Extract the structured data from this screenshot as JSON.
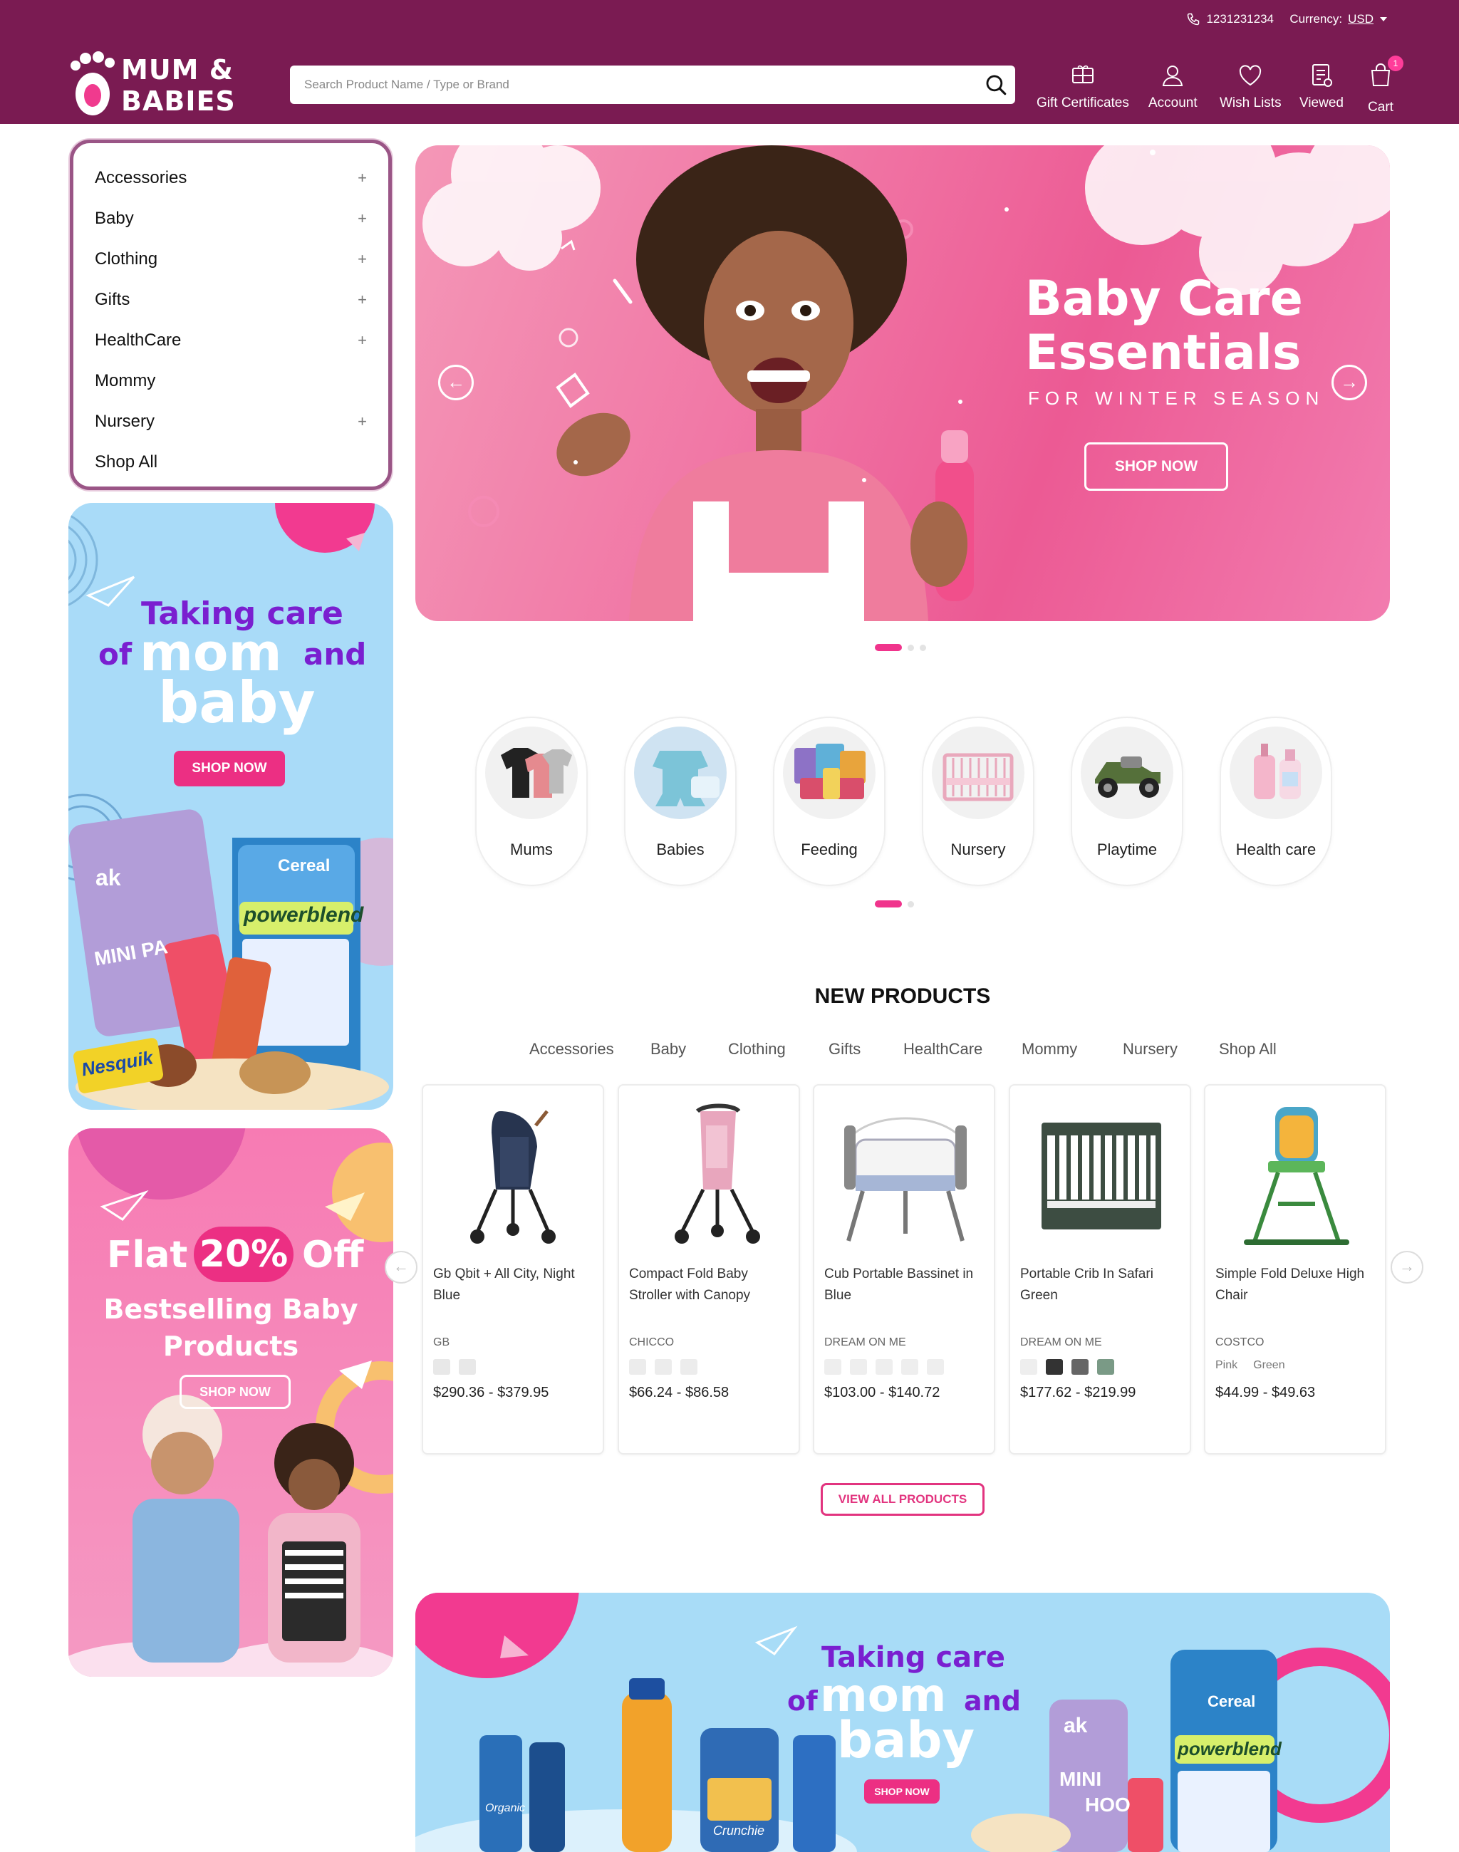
{
  "topbar": {
    "phone": "1231231234",
    "currency_label": "Currency:",
    "currency_value": "USD"
  },
  "header": {
    "logo_text_1": "MUM &",
    "logo_text_2": "BABIES",
    "search_placeholder": "Search Product Name / Type or Brand",
    "nav": [
      {
        "label": "Gift Certificates",
        "icon": "gift-certificate-icon"
      },
      {
        "label": "Account",
        "icon": "user-icon"
      },
      {
        "label": "Wish Lists",
        "icon": "heart-icon"
      },
      {
        "label": "Viewed",
        "icon": "viewed-list-icon"
      },
      {
        "label": "Cart",
        "icon": "shopping-bag-icon",
        "badge": "1"
      }
    ]
  },
  "sidebar": {
    "categories": [
      {
        "label": "Accessories",
        "expand": "+"
      },
      {
        "label": "Baby",
        "expand": "+"
      },
      {
        "label": "Clothing",
        "expand": "+"
      },
      {
        "label": "Gifts",
        "expand": "+"
      },
      {
        "label": "HealthCare",
        "expand": "+"
      },
      {
        "label": "Mommy",
        "expand": ""
      },
      {
        "label": "Nursery",
        "expand": "+"
      },
      {
        "label": "Shop All",
        "expand": ""
      }
    ],
    "banner1": {
      "line1": "Taking care",
      "line2a": "of",
      "line2b": "mom",
      "line2c": "and",
      "line3": "baby",
      "button": "SHOP NOW",
      "pkg_text_1": "Cereal",
      "pkg_text_2": "powerblend",
      "pkg_text_3": "ak",
      "pkg_text_4": "MINI PA",
      "pkg_text_5": "Nesquik"
    },
    "banner2": {
      "line1a": "Flat",
      "line1b": "20%",
      "line1c": "Off",
      "line2": "Bestselling Baby",
      "line3": "Products",
      "button": "SHOP NOW"
    }
  },
  "hero": {
    "title_1": "Baby Care",
    "title_2": "Essentials",
    "subtitle": "FOR WINTER SEASON",
    "button": "SHOP NOW",
    "prev": "←",
    "next": "→"
  },
  "category_circles": [
    {
      "label": "Mums"
    },
    {
      "label": "Babies"
    },
    {
      "label": "Feeding"
    },
    {
      "label": "Nursery"
    },
    {
      "label": "Playtime"
    },
    {
      "label": "Health care"
    }
  ],
  "new_products": {
    "title": "NEW PRODUCTS",
    "tabs": [
      "Accessories",
      "Baby",
      "Clothing",
      "Gifts",
      "HealthCare",
      "Mommy",
      "Nursery",
      "Shop All"
    ],
    "items": [
      {
        "name": "Gb Qbit + All City, Night Blue",
        "brand": "GB",
        "price": "$290.36 - $379.95"
      },
      {
        "name": "Compact Fold Baby Stroller with Canopy",
        "brand": "CHICCO",
        "price": "$66.24 - $86.58"
      },
      {
        "name": "Cub Portable Bassinet in Blue",
        "brand": "DREAM ON ME",
        "price": "$103.00 - $140.72"
      },
      {
        "name": "Portable Crib In Safari Green",
        "brand": "DREAM ON ME",
        "price": "$177.62 - $219.99"
      },
      {
        "name": "Simple Fold Deluxe High Chair",
        "brand": "COSTCO",
        "price": "$44.99 - $49.63",
        "swatch_1": "Pink",
        "swatch_2": "Green"
      }
    ],
    "view_all": "VIEW ALL PRODUCTS",
    "prev": "←",
    "next": "→"
  },
  "bottom_banner": {
    "line1": "Taking care",
    "line2a": "of",
    "line2b": "mom",
    "line2c": "and",
    "line3": "baby",
    "button": "SHOP NOW",
    "pkg_text_1": "Cereal",
    "pkg_text_2": "powerblend",
    "pkg_text_3": "Organic",
    "pkg_text_4": "Crunchie",
    "pkg_text_5": "ak",
    "pkg_text_6": "MINI",
    "pkg_text_7": "HOO"
  },
  "colors": {
    "header_bg": "#7a1b52",
    "accent_pink": "#ec2f83",
    "hero_pink": "#f178a6",
    "banner_blue": "#a8dcf7",
    "purple_text": "#7a1fd0"
  }
}
